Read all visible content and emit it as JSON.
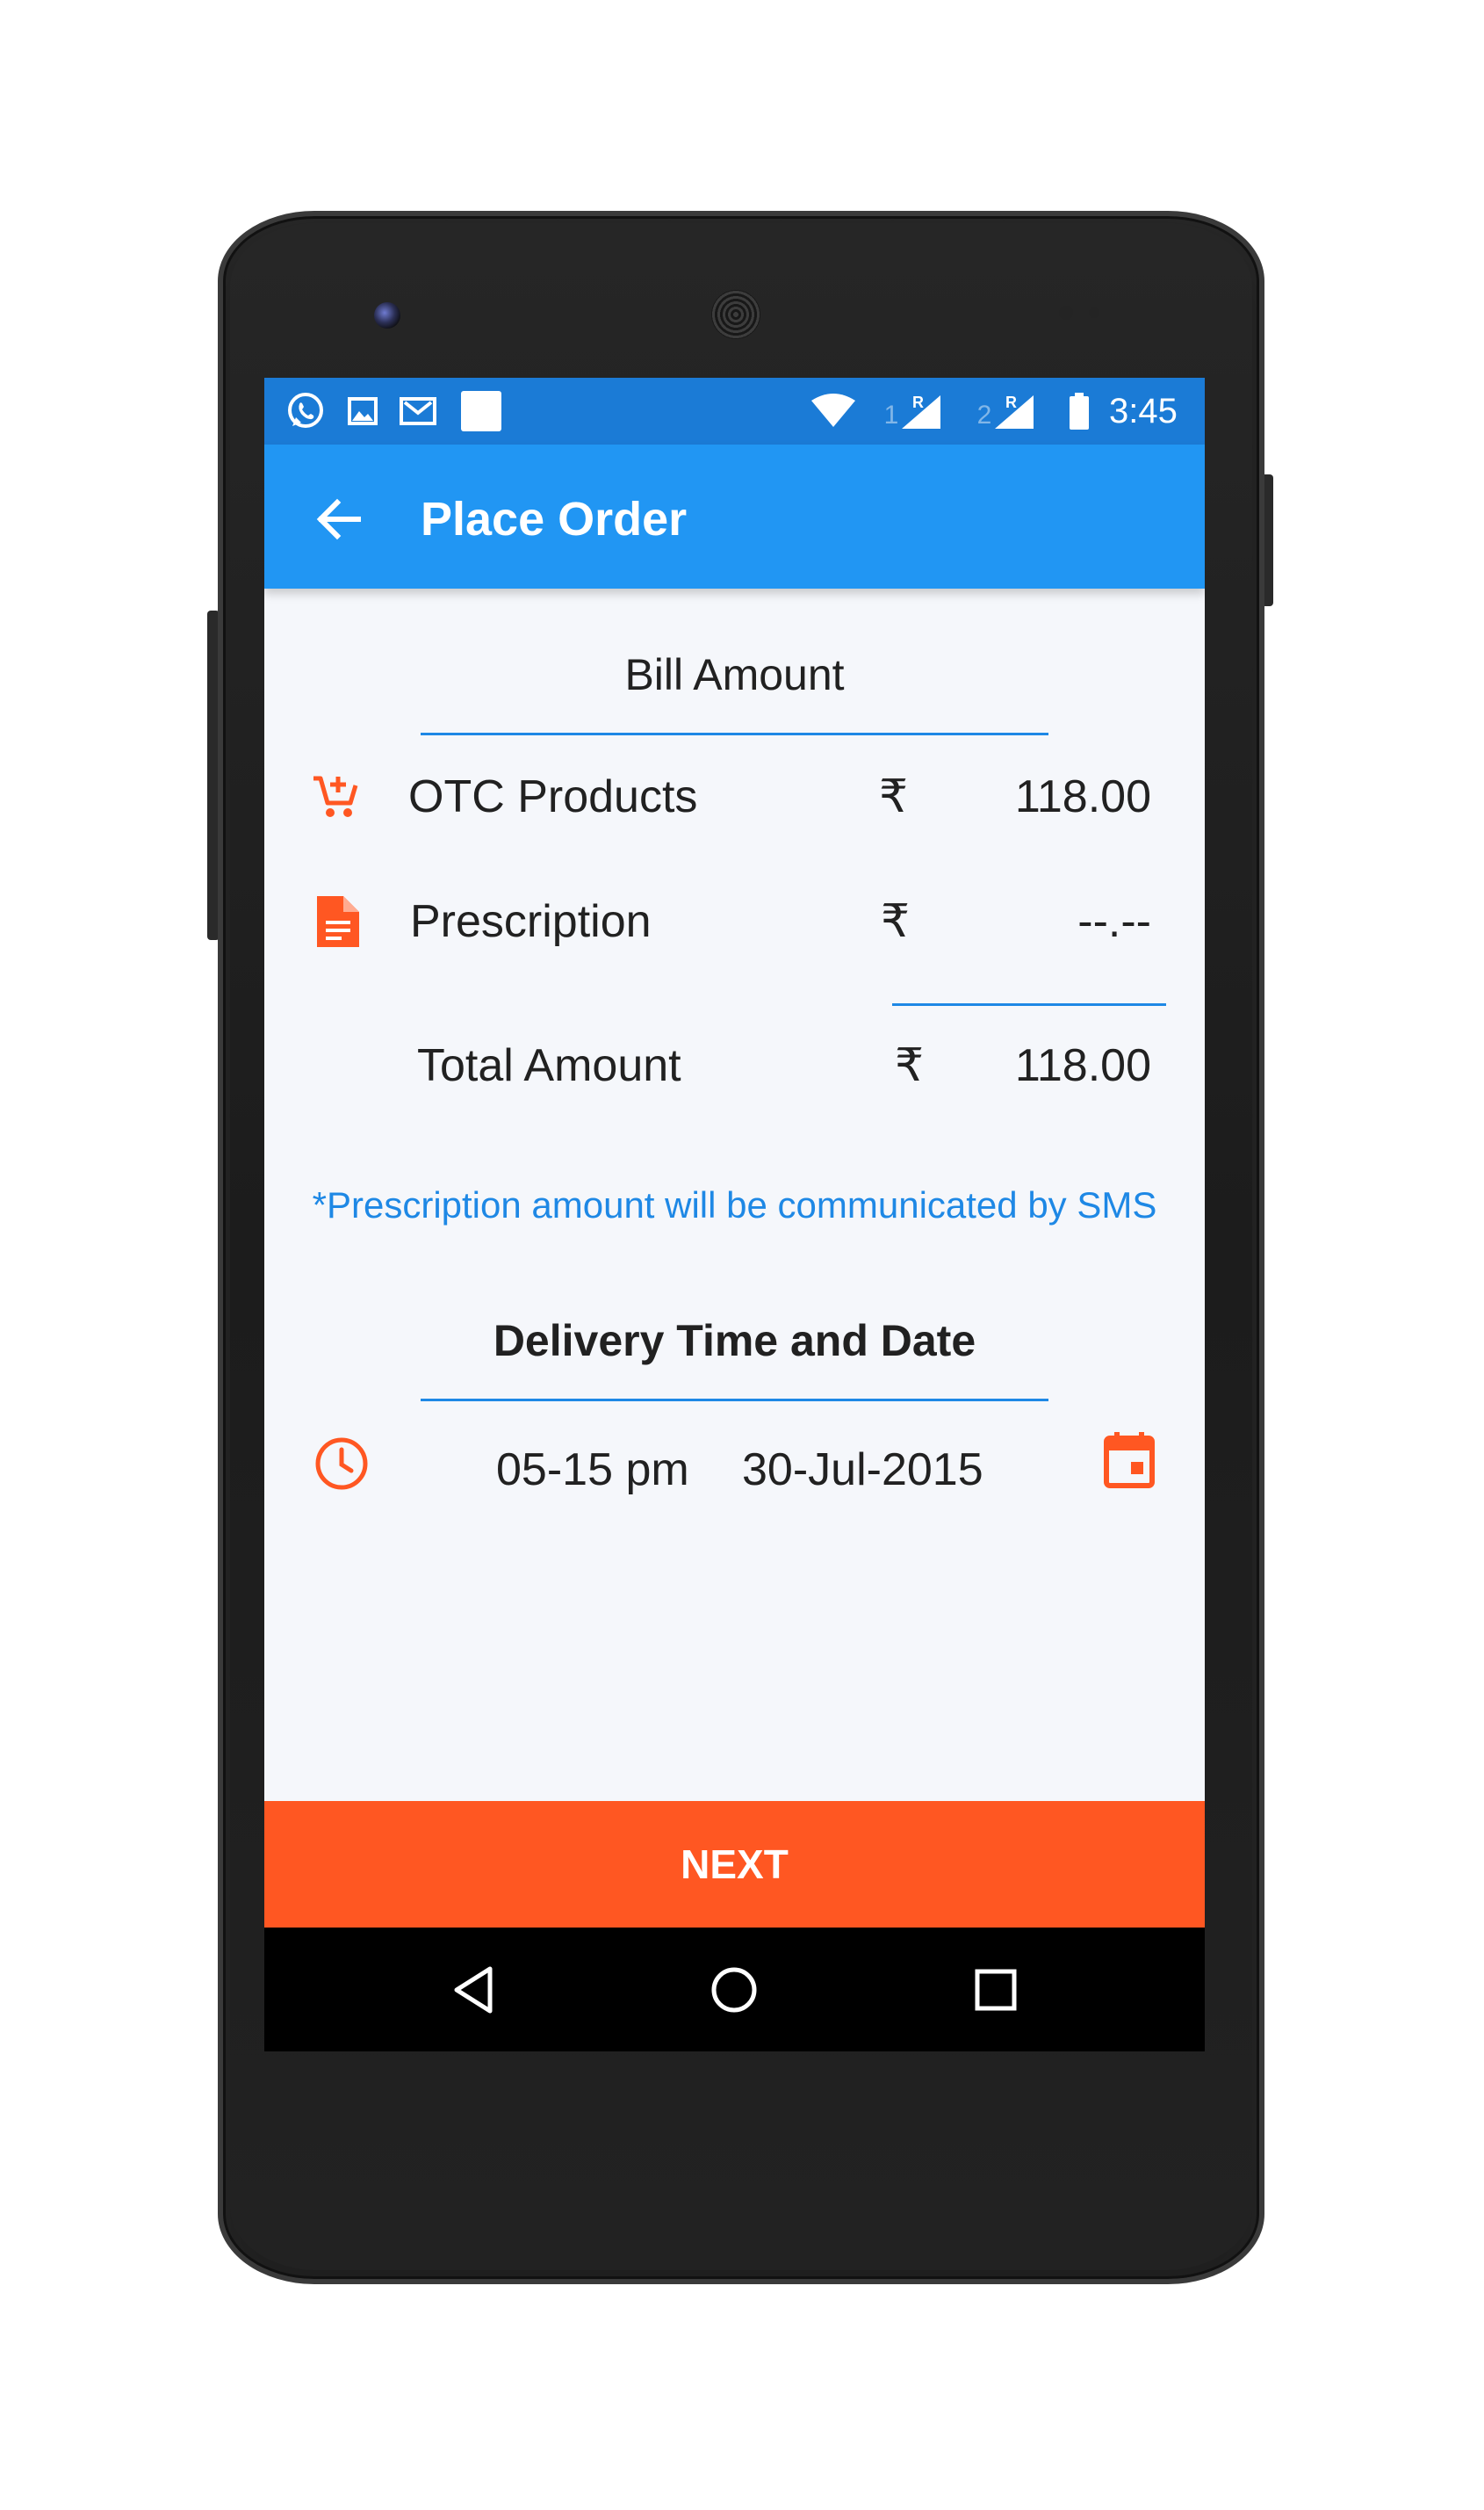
{
  "status_bar": {
    "time": "3:45",
    "sim1_label": "1",
    "sim2_label": "2",
    "roaming_label": "R",
    "icons": [
      "whatsapp-icon",
      "image-icon",
      "gmail-icon",
      "notification-icon",
      "wifi-icon",
      "signal-sim1-icon",
      "signal-sim2-icon",
      "battery-icon"
    ]
  },
  "app_bar": {
    "title": "Place Order",
    "back_icon": "arrow-back-icon"
  },
  "bill": {
    "heading": "Bill Amount",
    "currency_symbol": "₹",
    "otc": {
      "label": "OTC Products",
      "value": "118.00",
      "icon": "cart-add-icon"
    },
    "prescription": {
      "label": "Prescription",
      "value": "--.--",
      "icon": "document-icon"
    },
    "total": {
      "label": "Total Amount",
      "value": "118.00"
    },
    "note": "*Prescription amount will be communicated by SMS"
  },
  "delivery": {
    "heading": "Delivery Time and Date",
    "time": "05-15 pm",
    "date": "30-Jul-2015",
    "time_icon": "clock-icon",
    "date_icon": "calendar-icon"
  },
  "actions": {
    "next_label": "NEXT"
  },
  "nav_bar": {
    "icons": [
      "nav-back-icon",
      "nav-home-icon",
      "nav-recents-icon"
    ]
  },
  "colors": {
    "status_bar": "#1b7bd6",
    "app_bar": "#2196f3",
    "accent_orange": "#ff5722",
    "accent_blue": "#1e88e5",
    "background": "#f5f7fb"
  }
}
